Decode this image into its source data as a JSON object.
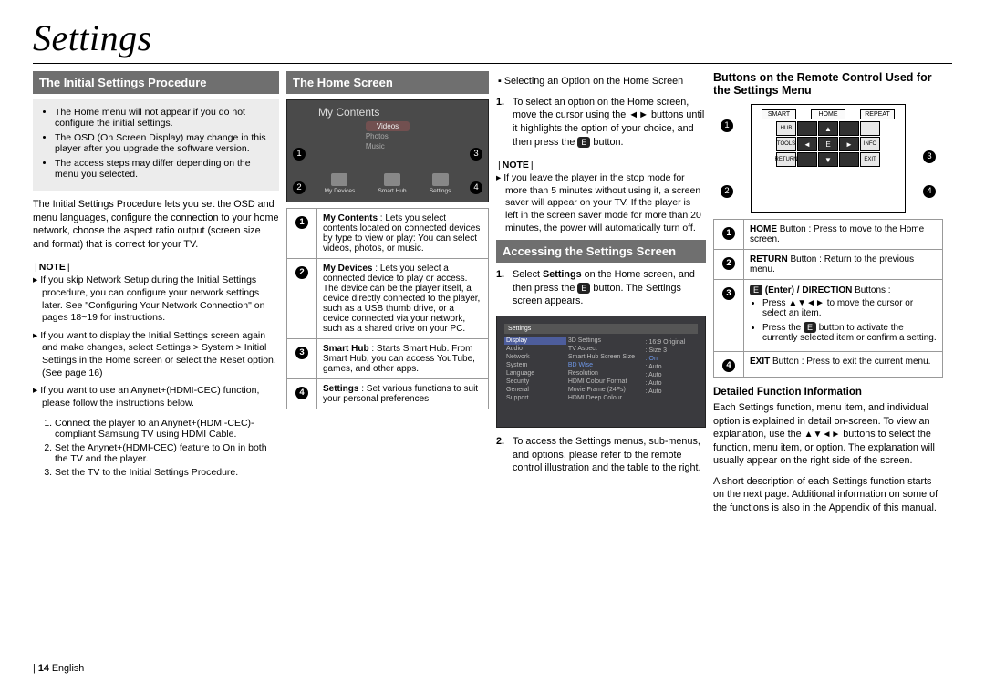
{
  "page_title": "Settings",
  "section_initial": "The Initial Settings Procedure",
  "section_home": "The Home Screen",
  "section_access": "Accessing the Settings Screen",
  "heading_remote": "Buttons on the Remote Control Used for the Settings Menu",
  "heading_detail": "Detailed Function Information",
  "boxed_notes": [
    "The Home menu will not appear if you do not configure the initial settings.",
    "The OSD (On Screen Display) may change in this player after you upgrade the software version.",
    "The access steps may differ depending on the menu you selected."
  ],
  "initial_body": "The Initial Settings Procedure lets you set the OSD and menu languages, configure the connection to your home network, choose the aspect ratio output (screen size and format) that is correct for your TV.",
  "note_label": "NOTE",
  "initial_notes": [
    "If you skip Network Setup during the Initial Settings procedure, you can configure your network settings later. See \"Configuring Your Network Connection\" on pages 18~19 for instructions.",
    "If you want to display the Initial Settings screen again and make changes, select Settings > System > Initial Settings in the Home screen or select the Reset option. (See page 16)",
    "If you want to use an Anynet+(HDMI-CEC) function, please follow the instructions below."
  ],
  "initial_sublist": [
    "Connect the player to an Anynet+(HDMI-CEC)-compliant Samsung TV using HDMI Cable.",
    "Set the Anynet+(HDMI-CEC) feature to On in both the TV and the player.",
    "Set the TV to the Initial Settings Procedure."
  ],
  "home_screen": {
    "title": "My Contents",
    "menu": [
      "Videos",
      "Photos",
      "Music"
    ],
    "icons": [
      "My Devices",
      "Smart Hub",
      "Settings"
    ]
  },
  "home_table": [
    {
      "n": "1",
      "name": "My Contents",
      "desc": " : Lets you select contents located on connected devices by type to view or play: You can select videos, photos, or music."
    },
    {
      "n": "2",
      "name": "My Devices",
      "desc": " : Lets you select a connected device to play or access. The device can be the player itself, a device directly connected to the player, such as a USB thumb drive, or a device connected via your network, such as a shared drive on your PC."
    },
    {
      "n": "3",
      "name": "Smart Hub",
      "desc": " : Starts Smart Hub. From Smart Hub, you can access YouTube, games, and other apps."
    },
    {
      "n": "4",
      "name": "Settings",
      "desc": " : Set various functions to suit your personal preferences."
    }
  ],
  "select_head": "Selecting an Option on the Home Screen",
  "home_step1": {
    "n": "1.",
    "a": "To select an option on the Home screen, move the cursor using the ",
    "b": " buttons until it highlights the option of your choice, and then press the ",
    "c": " button."
  },
  "home_note": "If you leave the player in the stop mode for more than 5 minutes without using it, a screen saver will appear on your TV. If the player is left in the screen saver mode for more than 20 minutes, the power will automatically turn off.",
  "access_step1": {
    "n": "1.",
    "a": "Select ",
    "bold": "Settings",
    "b": " on the Home screen, and then press the ",
    "c": " button. The Settings screen appears."
  },
  "access_step2": {
    "n": "2.",
    "text": "To access the Settings menus, sub-menus, and options, please refer to the remote control illustration and the table to the right."
  },
  "settings_screen": {
    "header": "Settings",
    "left": [
      "Display",
      "Audio",
      "Network",
      "System",
      "Language",
      "Security",
      "General",
      "Support"
    ],
    "mid": [
      "3D Settings",
      "TV Aspect",
      "Smart Hub Screen Size",
      "BD Wise",
      "Resolution",
      "HDMI Colour Format",
      "Movie Frame (24Fs)",
      "HDMI Deep Colour"
    ],
    "right": [
      "",
      ": 16:9 Original",
      ": Size 3",
      ": On",
      ": Auto",
      ": Auto",
      ": Auto",
      ": Auto"
    ]
  },
  "remote_labels": [
    "SMART",
    "HOME",
    "REPEAT",
    "HUB",
    "",
    "",
    "TOOLS",
    "",
    "INFO",
    "RETURN",
    "",
    "EXIT"
  ],
  "remote_table": [
    {
      "n": "1",
      "bold": "HOME",
      "suffix": " Button : Press to move to the Home screen."
    },
    {
      "n": "2",
      "bold": "RETURN",
      "suffix": " Button : Return to the previous menu."
    },
    {
      "n": "3",
      "bold_a": "E",
      "mid": " (Enter) / ",
      "bold_b": "DIRECTION",
      "suffix": " Buttons :",
      "bullets": [
        {
          "a": "Press ",
          "b": " to move the cursor or select an item."
        },
        {
          "a": "Press the ",
          "b": " button to activate the currently selected item or confirm a setting."
        }
      ]
    },
    {
      "n": "4",
      "bold": "EXIT",
      "suffix": " Button : Press to exit the current menu."
    }
  ],
  "detail_p1a": "Each Settings function, menu item, and individual option is explained in detail on-screen. To view an explanation, use the",
  "detail_p1b": " buttons to select the function, menu item, or option. The explanation will usually appear on the right side of the screen.",
  "detail_p2": "A short description of each Settings function starts on the next page. Additional information on some of the functions is also in the Appendix of this manual.",
  "page_num": "14",
  "page_lang": "English"
}
